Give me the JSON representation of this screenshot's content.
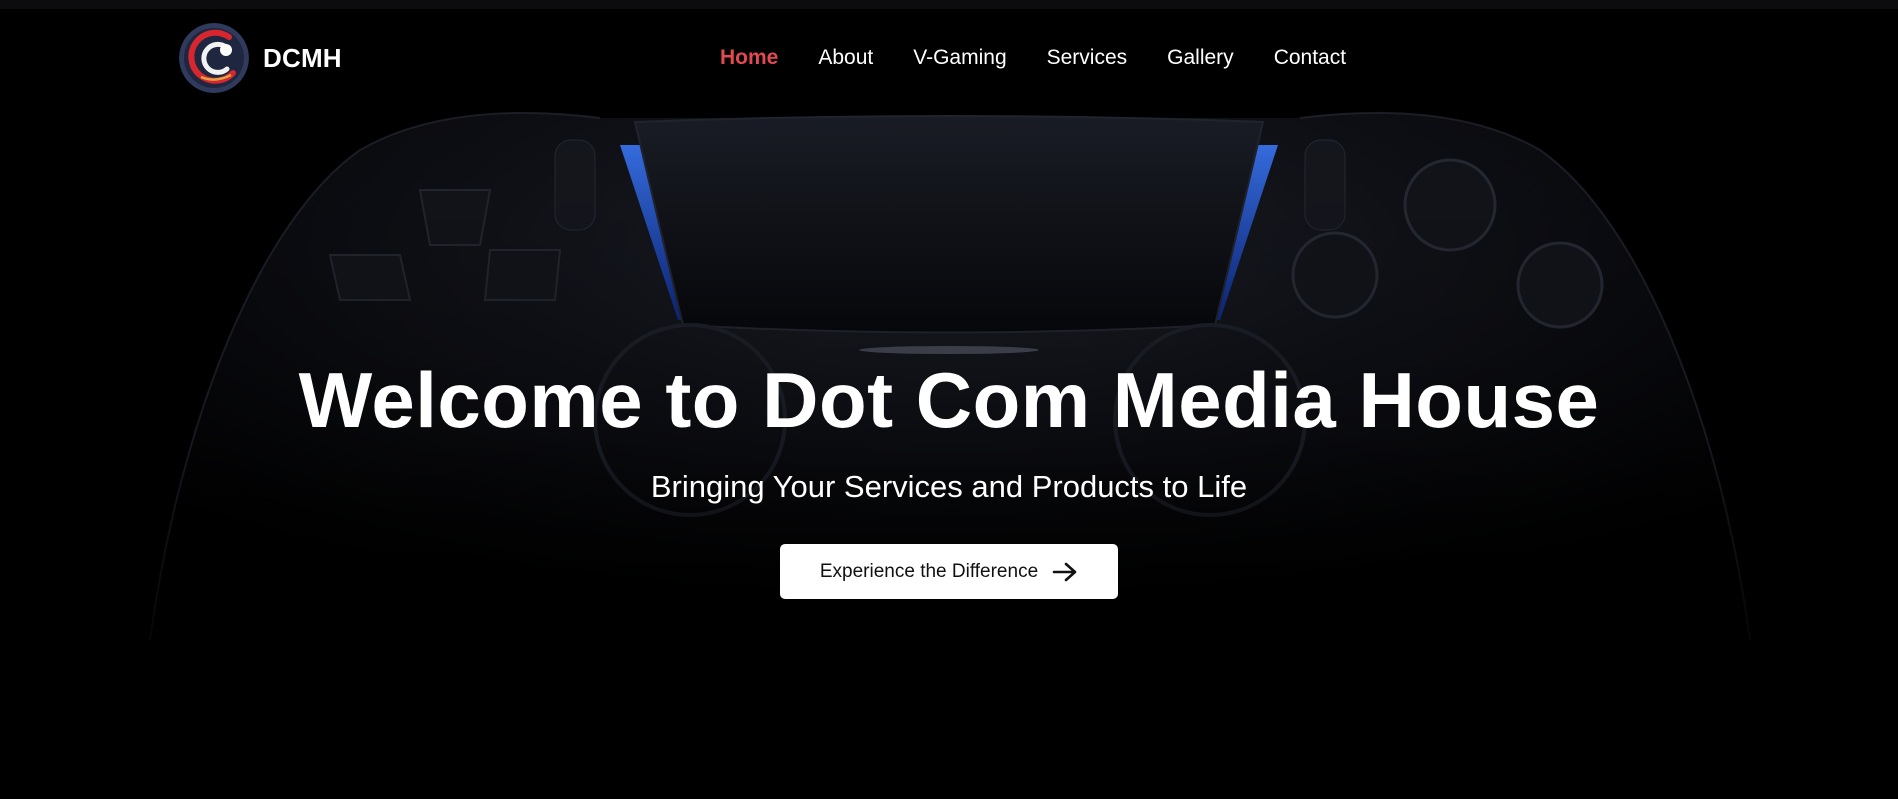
{
  "brand": {
    "name": "DCMH",
    "logo_icon": "dcmh-logo-icon"
  },
  "nav": {
    "items": [
      {
        "label": "Home",
        "active": true
      },
      {
        "label": "About",
        "active": false
      },
      {
        "label": "V-Gaming",
        "active": false
      },
      {
        "label": "Services",
        "active": false
      },
      {
        "label": "Gallery",
        "active": false
      },
      {
        "label": "Contact",
        "active": false
      }
    ]
  },
  "hero": {
    "title": "Welcome to Dot Com Media House",
    "subtitle": "Bringing Your Services and Products to Life",
    "cta_label": "Experience the Difference",
    "cta_icon": "arrow-right-icon",
    "background": "game-controller-image"
  },
  "colors": {
    "background": "#000000",
    "accent": "#e24a4f",
    "text": "#ffffff",
    "controller_glow": "#2f6bff"
  }
}
